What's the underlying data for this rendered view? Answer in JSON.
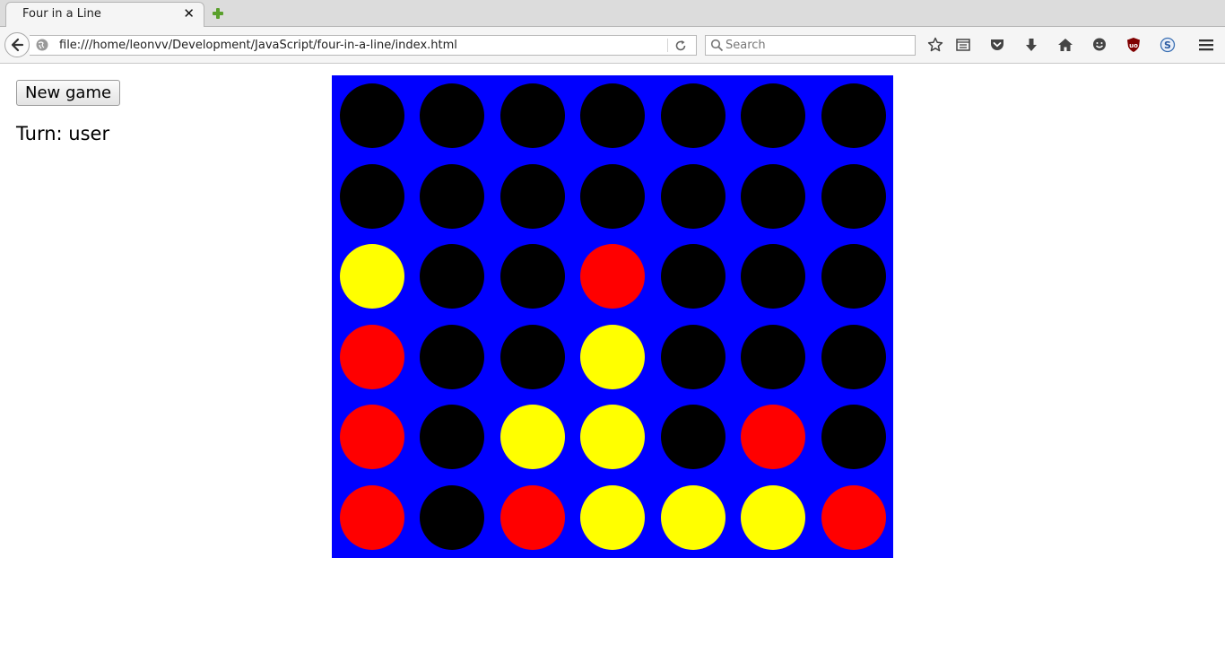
{
  "browser": {
    "tab_title": "Four in a Line",
    "tab_close_glyph": "✕",
    "url": "file:///home/leonvv/Development/JavaScript/four-in-a-line/index.html",
    "search_placeholder": "Search",
    "toolbar_icons": [
      "bookmark-star-icon",
      "reading-list-icon",
      "pocket-icon",
      "download-icon",
      "home-icon",
      "chat-icon",
      "ublock-icon",
      "sync-icon",
      "menu-icon"
    ]
  },
  "game": {
    "new_game_label": "New game",
    "turn_label": "Turn:",
    "turn_value": "user",
    "colors": {
      "board": "#0000ff",
      "empty": "#000000",
      "red": "#ff0000",
      "yellow": "#ffff00"
    },
    "grid": [
      [
        "empty",
        "empty",
        "empty",
        "empty",
        "empty",
        "empty",
        "empty"
      ],
      [
        "empty",
        "empty",
        "empty",
        "empty",
        "empty",
        "empty",
        "empty"
      ],
      [
        "yellow",
        "empty",
        "empty",
        "red",
        "empty",
        "empty",
        "empty"
      ],
      [
        "red",
        "empty",
        "empty",
        "yellow",
        "empty",
        "empty",
        "empty"
      ],
      [
        "red",
        "empty",
        "yellow",
        "yellow",
        "empty",
        "red",
        "empty"
      ],
      [
        "red",
        "empty",
        "red",
        "yellow",
        "yellow",
        "yellow",
        "red"
      ]
    ]
  }
}
